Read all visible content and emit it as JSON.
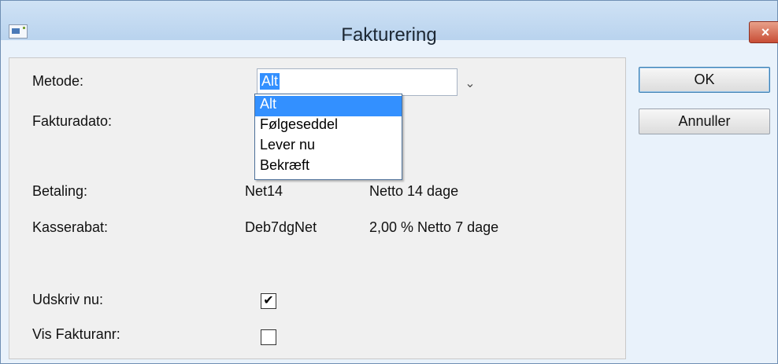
{
  "window": {
    "title": "Fakturering",
    "close_symbol": "×"
  },
  "labels": {
    "metode": "Metode:",
    "fakturadato": "Fakturadato:",
    "betaling": "Betaling:",
    "kasserabat": "Kasserabat:",
    "udskriv_nu": "Udskriv nu:",
    "vis_fakturanr": "Vis Fakturanr:"
  },
  "metode": {
    "value": "Alt",
    "options": [
      "Alt",
      "Følgeseddel",
      "Lever nu",
      "Bekræft"
    ],
    "selected_index": 0
  },
  "betaling": {
    "code": "Net14",
    "description": "Netto 14 dage"
  },
  "kasserabat": {
    "code": "Deb7dgNet",
    "description": "2,00 % Netto 7 dage"
  },
  "checkboxes": {
    "udskriv_nu": {
      "checked": true,
      "mark": "✔"
    },
    "vis_fakturanr": {
      "checked": false,
      "mark": ""
    }
  },
  "buttons": {
    "ok": "OK",
    "cancel": "Annuller"
  },
  "icons": {
    "app": "window-icon",
    "close": "close-icon",
    "dropdown": "chevron-down-icon"
  }
}
